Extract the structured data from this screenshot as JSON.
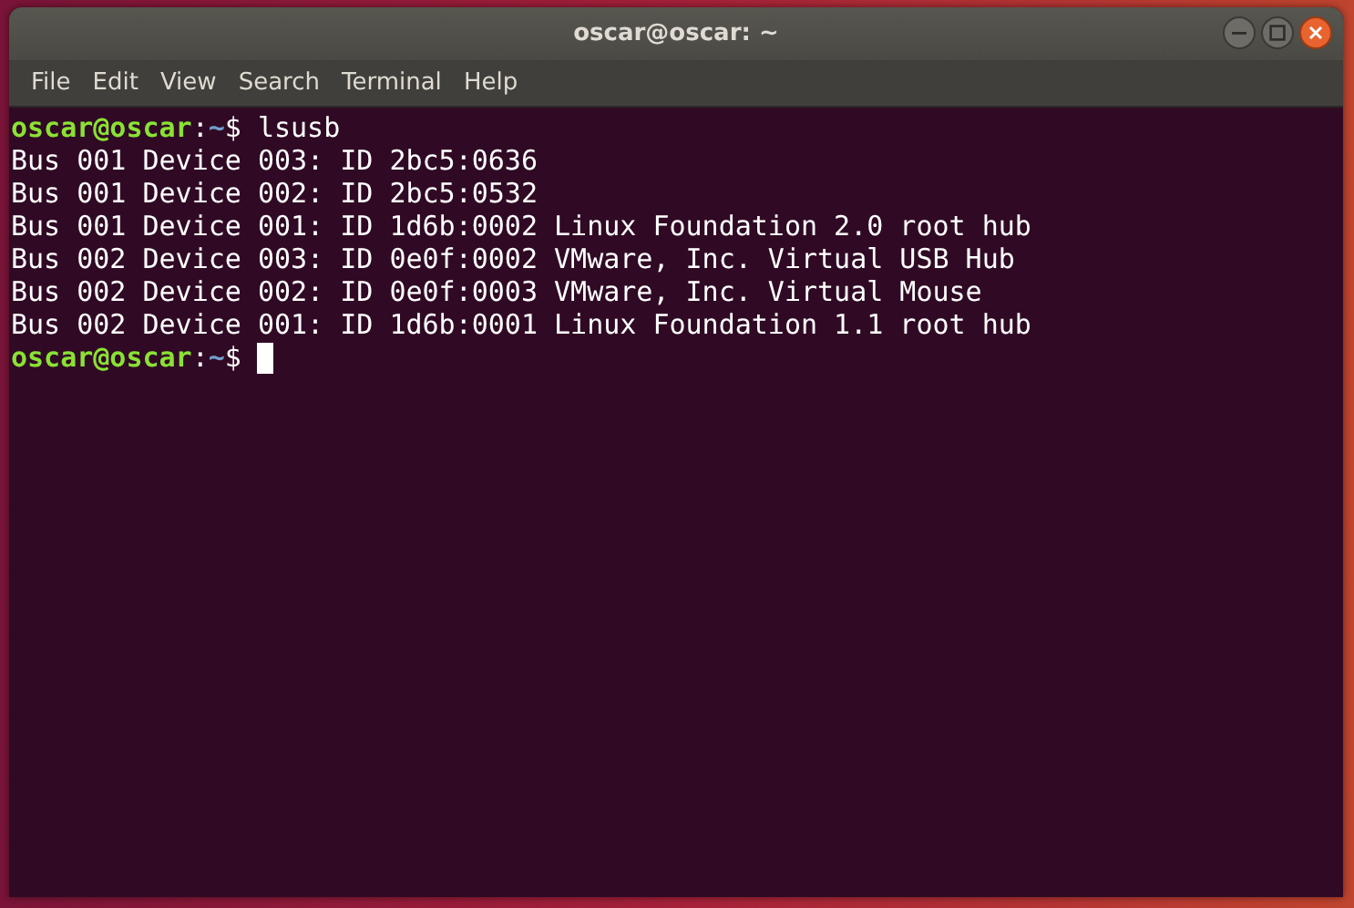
{
  "window": {
    "title": "oscar@oscar: ~"
  },
  "menu": [
    "File",
    "Edit",
    "View",
    "Search",
    "Terminal",
    "Help"
  ],
  "terminal": {
    "lines": [
      {
        "kind": "prompt",
        "user_host": "oscar@oscar",
        "separator": ":",
        "path": "~",
        "symbol": "$",
        "command": "lsusb",
        "cursor": false
      },
      {
        "kind": "output",
        "text": "Bus 001 Device 003: ID 2bc5:0636"
      },
      {
        "kind": "output",
        "text": "Bus 001 Device 002: ID 2bc5:0532"
      },
      {
        "kind": "output",
        "text": "Bus 001 Device 001: ID 1d6b:0002 Linux Foundation 2.0 root hub"
      },
      {
        "kind": "output",
        "text": "Bus 002 Device 003: ID 0e0f:0002 VMware, Inc. Virtual USB Hub"
      },
      {
        "kind": "output",
        "text": "Bus 002 Device 002: ID 0e0f:0003 VMware, Inc. Virtual Mouse"
      },
      {
        "kind": "output",
        "text": "Bus 002 Device 001: ID 1d6b:0001 Linux Foundation 1.1 root hub"
      },
      {
        "kind": "prompt",
        "user_host": "oscar@oscar",
        "separator": ":",
        "path": "~",
        "symbol": "$",
        "cursor": true
      }
    ]
  }
}
